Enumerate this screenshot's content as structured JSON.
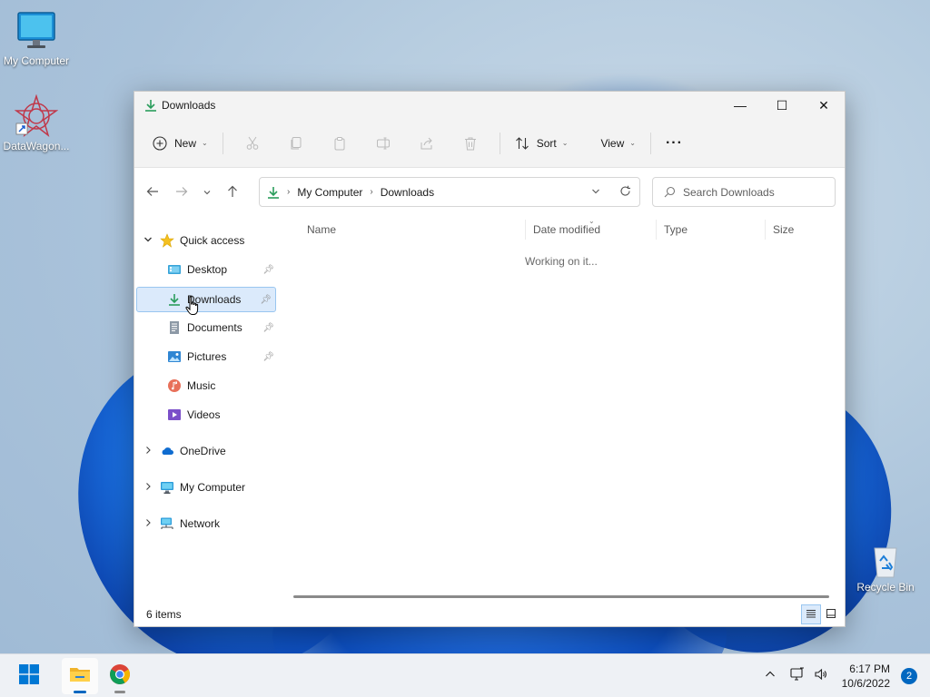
{
  "desktop": {
    "icons": [
      {
        "label": "My Computer"
      },
      {
        "label": "DataWagon..."
      },
      {
        "label": "Recycle Bin"
      }
    ]
  },
  "window": {
    "title": "Downloads",
    "controls": {
      "minimize": "—",
      "maximize": "☐",
      "close": "✕"
    }
  },
  "toolbar": {
    "new_label": "New",
    "sort_label": "Sort",
    "view_label": "View",
    "more_label": "···"
  },
  "address": {
    "crumbs": [
      "My Computer",
      "Downloads"
    ]
  },
  "search": {
    "placeholder": "Search Downloads"
  },
  "nav": {
    "quick_access": "Quick access",
    "items": [
      {
        "label": "Desktop"
      },
      {
        "label": "Downloads"
      },
      {
        "label": "Documents"
      },
      {
        "label": "Pictures"
      },
      {
        "label": "Music"
      },
      {
        "label": "Videos"
      }
    ],
    "onedrive": "OneDrive",
    "my_computer": "My Computer",
    "network": "Network"
  },
  "filelist": {
    "columns": [
      "Name",
      "Date modified",
      "Type",
      "Size"
    ],
    "status_message": "Working on it..."
  },
  "statusbar": {
    "item_count": "6 items"
  },
  "taskbar": {
    "time": "6:17 PM",
    "date": "10/6/2022",
    "notifications": "2"
  },
  "colors": {
    "accent": "#0067c0",
    "download_green": "#2a9d5c",
    "selected_bg": "#dbeafb"
  }
}
